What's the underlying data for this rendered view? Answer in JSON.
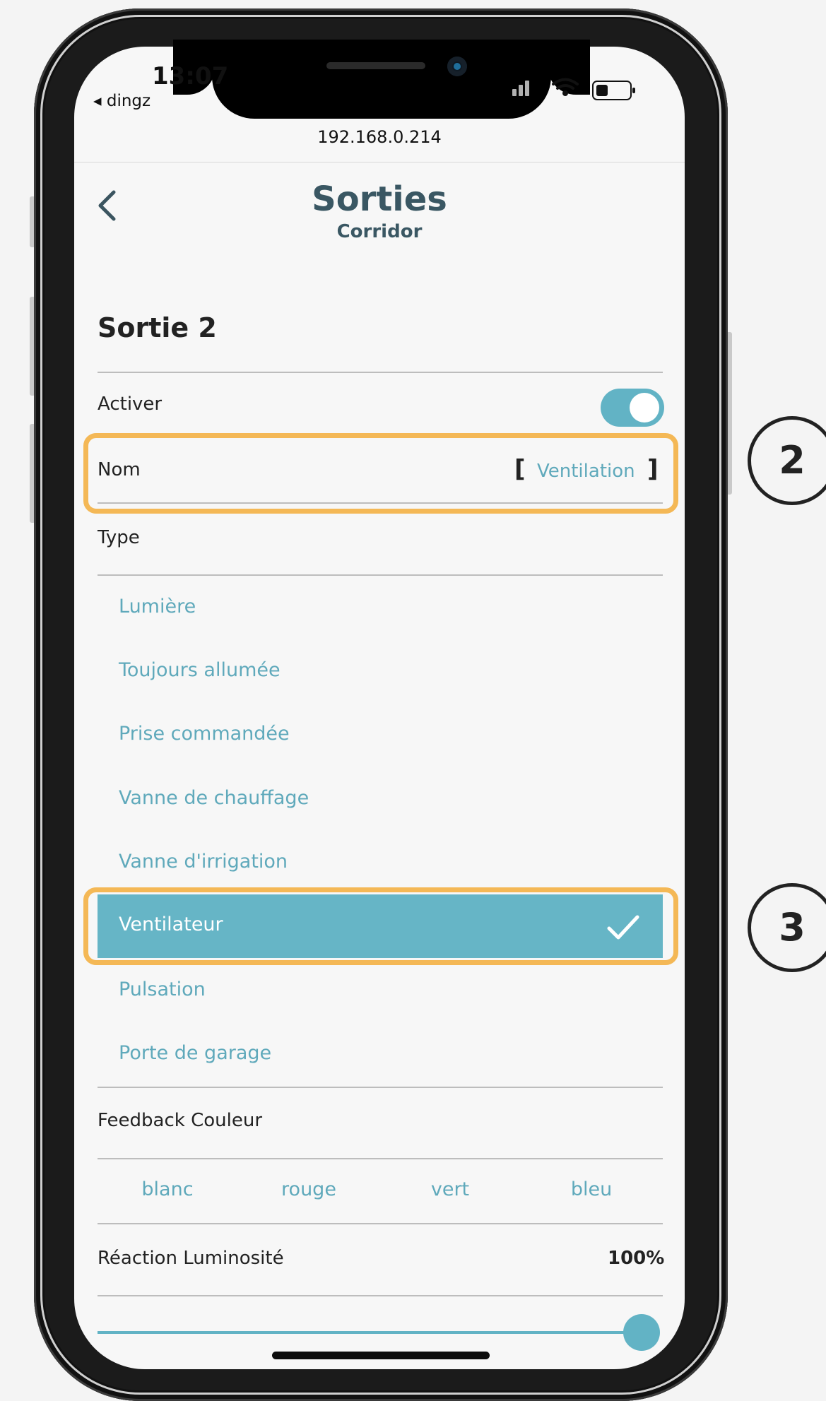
{
  "status_bar": {
    "time": "13:07",
    "back_app": "◂ dingz",
    "signal_wifi": "ııl ᯤ"
  },
  "url_bar": {
    "url": "192.168.0.214"
  },
  "header": {
    "back_icon": "chevron-left",
    "title": "Sorties",
    "subtitle": "Corridor"
  },
  "section": {
    "title": "Sortie 2"
  },
  "enable": {
    "label": "Activer",
    "value": true
  },
  "name": {
    "label": "Nom",
    "open_bracket": "[",
    "value": "Ventilation",
    "close_bracket": "]"
  },
  "type": {
    "label": "Type",
    "options": [
      "Lumière",
      "Toujours allumée",
      "Prise commandée",
      "Vanne de chauffage",
      "Vanne d'irrigation",
      "Ventilateur",
      "Pulsation",
      "Porte de garage"
    ],
    "selected": "Ventilateur"
  },
  "feedback": {
    "label": "Feedback Couleur",
    "options": [
      "blanc",
      "rouge",
      "vert",
      "bleu"
    ]
  },
  "brightness": {
    "label": "Réaction Luminosité",
    "value": "100%",
    "slider_fraction": 1.0
  },
  "annotations": {
    "callout_2": "2",
    "callout_3": "3"
  },
  "colors": {
    "accent": "#62b3c5",
    "highlight": "#f4b856",
    "title": "#3a5763"
  }
}
